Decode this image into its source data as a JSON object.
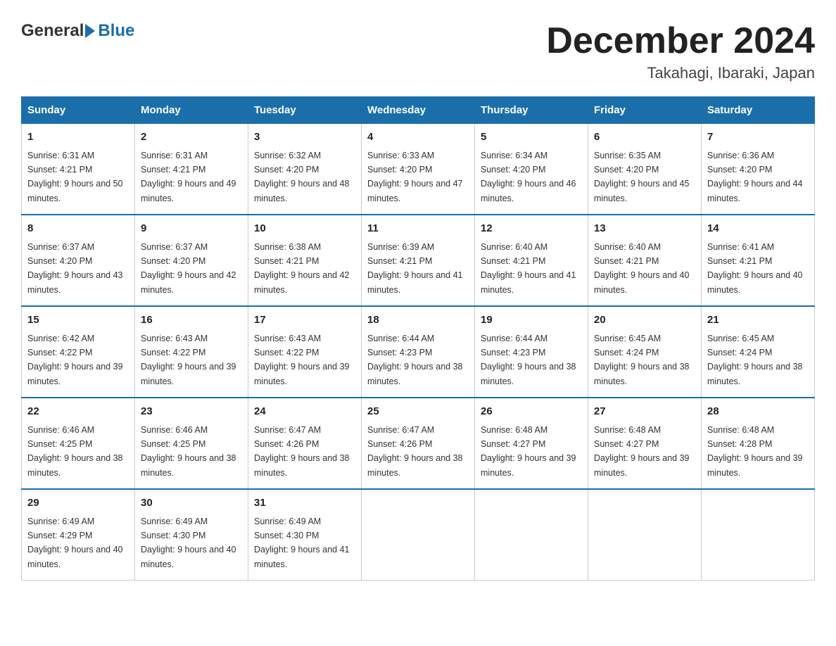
{
  "header": {
    "logo_general": "General",
    "logo_blue": "Blue",
    "month_title": "December 2024",
    "location": "Takahagi, Ibaraki, Japan"
  },
  "weekdays": [
    "Sunday",
    "Monday",
    "Tuesday",
    "Wednesday",
    "Thursday",
    "Friday",
    "Saturday"
  ],
  "weeks": [
    [
      {
        "day": "1",
        "sunrise": "6:31 AM",
        "sunset": "4:21 PM",
        "daylight": "9 hours and 50 minutes."
      },
      {
        "day": "2",
        "sunrise": "6:31 AM",
        "sunset": "4:21 PM",
        "daylight": "9 hours and 49 minutes."
      },
      {
        "day": "3",
        "sunrise": "6:32 AM",
        "sunset": "4:20 PM",
        "daylight": "9 hours and 48 minutes."
      },
      {
        "day": "4",
        "sunrise": "6:33 AM",
        "sunset": "4:20 PM",
        "daylight": "9 hours and 47 minutes."
      },
      {
        "day": "5",
        "sunrise": "6:34 AM",
        "sunset": "4:20 PM",
        "daylight": "9 hours and 46 minutes."
      },
      {
        "day": "6",
        "sunrise": "6:35 AM",
        "sunset": "4:20 PM",
        "daylight": "9 hours and 45 minutes."
      },
      {
        "day": "7",
        "sunrise": "6:36 AM",
        "sunset": "4:20 PM",
        "daylight": "9 hours and 44 minutes."
      }
    ],
    [
      {
        "day": "8",
        "sunrise": "6:37 AM",
        "sunset": "4:20 PM",
        "daylight": "9 hours and 43 minutes."
      },
      {
        "day": "9",
        "sunrise": "6:37 AM",
        "sunset": "4:20 PM",
        "daylight": "9 hours and 42 minutes."
      },
      {
        "day": "10",
        "sunrise": "6:38 AM",
        "sunset": "4:21 PM",
        "daylight": "9 hours and 42 minutes."
      },
      {
        "day": "11",
        "sunrise": "6:39 AM",
        "sunset": "4:21 PM",
        "daylight": "9 hours and 41 minutes."
      },
      {
        "day": "12",
        "sunrise": "6:40 AM",
        "sunset": "4:21 PM",
        "daylight": "9 hours and 41 minutes."
      },
      {
        "day": "13",
        "sunrise": "6:40 AM",
        "sunset": "4:21 PM",
        "daylight": "9 hours and 40 minutes."
      },
      {
        "day": "14",
        "sunrise": "6:41 AM",
        "sunset": "4:21 PM",
        "daylight": "9 hours and 40 minutes."
      }
    ],
    [
      {
        "day": "15",
        "sunrise": "6:42 AM",
        "sunset": "4:22 PM",
        "daylight": "9 hours and 39 minutes."
      },
      {
        "day": "16",
        "sunrise": "6:43 AM",
        "sunset": "4:22 PM",
        "daylight": "9 hours and 39 minutes."
      },
      {
        "day": "17",
        "sunrise": "6:43 AM",
        "sunset": "4:22 PM",
        "daylight": "9 hours and 39 minutes."
      },
      {
        "day": "18",
        "sunrise": "6:44 AM",
        "sunset": "4:23 PM",
        "daylight": "9 hours and 38 minutes."
      },
      {
        "day": "19",
        "sunrise": "6:44 AM",
        "sunset": "4:23 PM",
        "daylight": "9 hours and 38 minutes."
      },
      {
        "day": "20",
        "sunrise": "6:45 AM",
        "sunset": "4:24 PM",
        "daylight": "9 hours and 38 minutes."
      },
      {
        "day": "21",
        "sunrise": "6:45 AM",
        "sunset": "4:24 PM",
        "daylight": "9 hours and 38 minutes."
      }
    ],
    [
      {
        "day": "22",
        "sunrise": "6:46 AM",
        "sunset": "4:25 PM",
        "daylight": "9 hours and 38 minutes."
      },
      {
        "day": "23",
        "sunrise": "6:46 AM",
        "sunset": "4:25 PM",
        "daylight": "9 hours and 38 minutes."
      },
      {
        "day": "24",
        "sunrise": "6:47 AM",
        "sunset": "4:26 PM",
        "daylight": "9 hours and 38 minutes."
      },
      {
        "day": "25",
        "sunrise": "6:47 AM",
        "sunset": "4:26 PM",
        "daylight": "9 hours and 38 minutes."
      },
      {
        "day": "26",
        "sunrise": "6:48 AM",
        "sunset": "4:27 PM",
        "daylight": "9 hours and 39 minutes."
      },
      {
        "day": "27",
        "sunrise": "6:48 AM",
        "sunset": "4:27 PM",
        "daylight": "9 hours and 39 minutes."
      },
      {
        "day": "28",
        "sunrise": "6:48 AM",
        "sunset": "4:28 PM",
        "daylight": "9 hours and 39 minutes."
      }
    ],
    [
      {
        "day": "29",
        "sunrise": "6:49 AM",
        "sunset": "4:29 PM",
        "daylight": "9 hours and 40 minutes."
      },
      {
        "day": "30",
        "sunrise": "6:49 AM",
        "sunset": "4:30 PM",
        "daylight": "9 hours and 40 minutes."
      },
      {
        "day": "31",
        "sunrise": "6:49 AM",
        "sunset": "4:30 PM",
        "daylight": "9 hours and 41 minutes."
      },
      null,
      null,
      null,
      null
    ]
  ]
}
